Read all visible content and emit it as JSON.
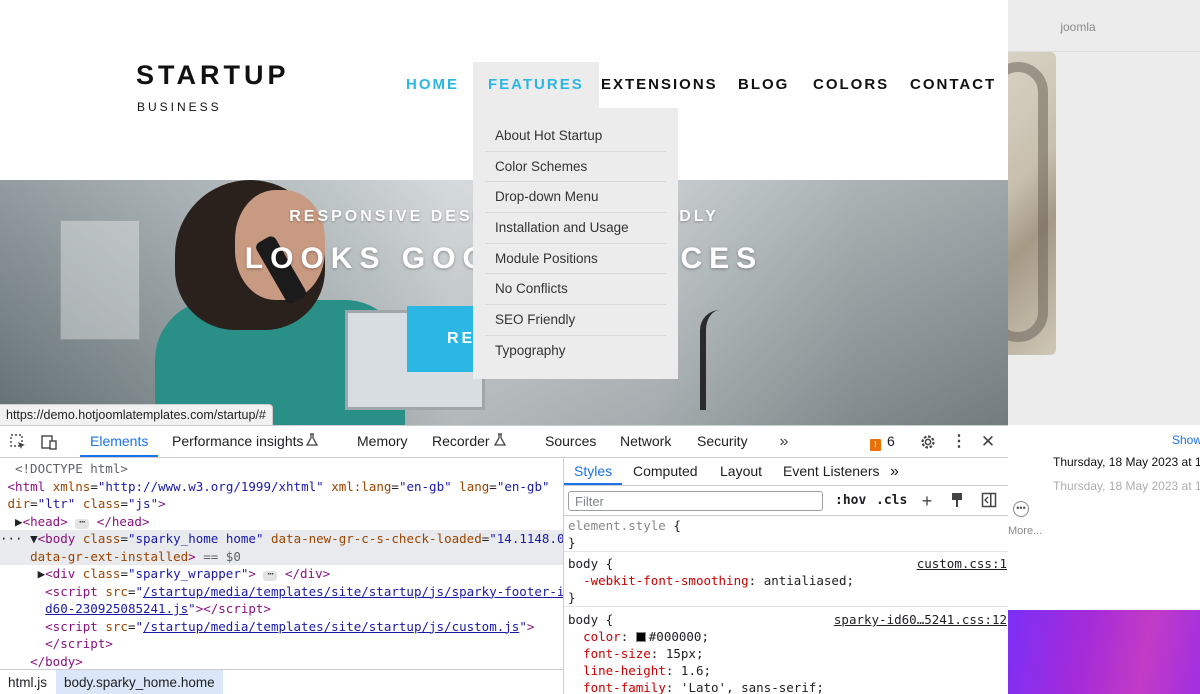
{
  "background_window": {
    "title": "joomla",
    "show_label": "Show",
    "date_1": "Thursday, 18 May 2023 at 1",
    "date_2": "Thursday, 18 May 2023 at 1",
    "more_label": "More..."
  },
  "site": {
    "logo_main": "STARTUP",
    "logo_sub": "BUSINESS",
    "nav": [
      {
        "label": "HOME"
      },
      {
        "label": "FEATURES"
      },
      {
        "label": "EXTENSIONS"
      },
      {
        "label": "BLOG"
      },
      {
        "label": "COLORS"
      },
      {
        "label": "CONTACT"
      }
    ],
    "dropdown": [
      "About Hot Startup",
      "Color Schemes",
      "Drop-down Menu",
      "Installation and Usage",
      "Module Positions",
      "No Conflicts",
      "SEO Friendly",
      "Typography"
    ],
    "hero_subtitle": "RESPONSIVE DESIGN / TOU                        LE FRIENDLY",
    "hero_title": "LOOKS GOOD O                DEVICES",
    "hero_button": "RE",
    "accent_color": "#2bb7e3",
    "status_url": "https://demo.hotjoomlatemplates.com/startup/#"
  },
  "devtools": {
    "tabs": [
      "Elements",
      "Performance insights",
      "Memory",
      "Recorder",
      "Sources",
      "Network",
      "Security"
    ],
    "issues_count": "6",
    "styles_tabs": [
      "Styles",
      "Computed",
      "Layout",
      "Event Listeners"
    ],
    "filter_placeholder": "Filter",
    "hov_label": ":hov",
    "cls_label": ".cls",
    "breadcrumbs": [
      "html.js",
      "body.sparky_home.home"
    ],
    "dom": {
      "doctype": "<!DOCTYPE html>",
      "html_xmlns": "http://www.w3.org/1999/xhtml",
      "html_xml_lang": "en-gb",
      "html_lang": "en-gb",
      "html_dir": "ltr",
      "html_class": "js",
      "body_class": "sparky_home home",
      "body_grammarly": "14.1148.0",
      "body_trailer": " == $0",
      "div_class": "sparky_wrapper",
      "script1_src_a": "/startup/media/templates/site/startup/js/sparky-footer-i",
      "script1_src_b": "d60-230925085241.js",
      "script2_src": "/startup/media/templates/site/startup/js/custom.js"
    },
    "styles": {
      "element_style": "element.style",
      "rule1_source": "custom.css:1",
      "rule1_prop": "-webkit-font-smoothing",
      "rule1_val": "antialiased",
      "rule2_source": "sparky-id60…5241.css:12",
      "color_prop": "color",
      "color_val": "#000000",
      "font_size_prop": "font-size",
      "font_size_val": "15px",
      "line_height_prop": "line-height",
      "line_height_val": "1.6",
      "font_family_prop": "font-family",
      "font_family_val": "'Lato', sans-serif"
    }
  }
}
